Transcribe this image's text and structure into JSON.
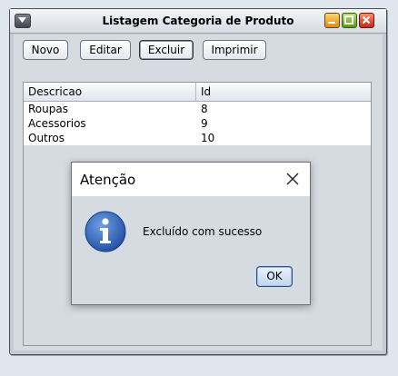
{
  "window": {
    "title": "Listagem Categoria de Produto"
  },
  "toolbar": {
    "novo_label": "Novo",
    "editar_label": "Editar",
    "excluir_label": "Excluir",
    "imprimir_label": "Imprimir"
  },
  "table": {
    "columns": [
      "Descricao",
      "Id"
    ],
    "rows": [
      [
        "Roupas",
        "8"
      ],
      [
        "Acessorios",
        "9"
      ],
      [
        "Outros",
        "10"
      ]
    ]
  },
  "dialog": {
    "title": "Atenção",
    "message": "Excluído com sucesso",
    "ok_label": "OK",
    "icon": "info-icon"
  },
  "colors": {
    "window_frame": "#c5cbd3",
    "minimize_button": "#f0a030",
    "maximize_button": "#7dbb2e",
    "close_button": "#e0483a",
    "info_icon_blue": "#2f63b8"
  }
}
